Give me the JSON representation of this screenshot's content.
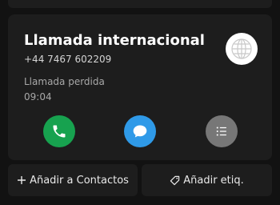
{
  "contact": {
    "name": "Llamada internacional",
    "number": "+44 7467 602209",
    "status": "Llamada perdida",
    "time": "09:04"
  },
  "actions": {
    "call_icon": "phone-icon",
    "message_icon": "message-bubble-icon",
    "details_icon": "list-icon"
  },
  "footer": {
    "add_contact_label": "Añadir a Contactos",
    "add_tag_label": "Añadir etiq."
  },
  "colors": {
    "call": "#17a24f",
    "message": "#2f9ae8",
    "details": "#777777"
  }
}
